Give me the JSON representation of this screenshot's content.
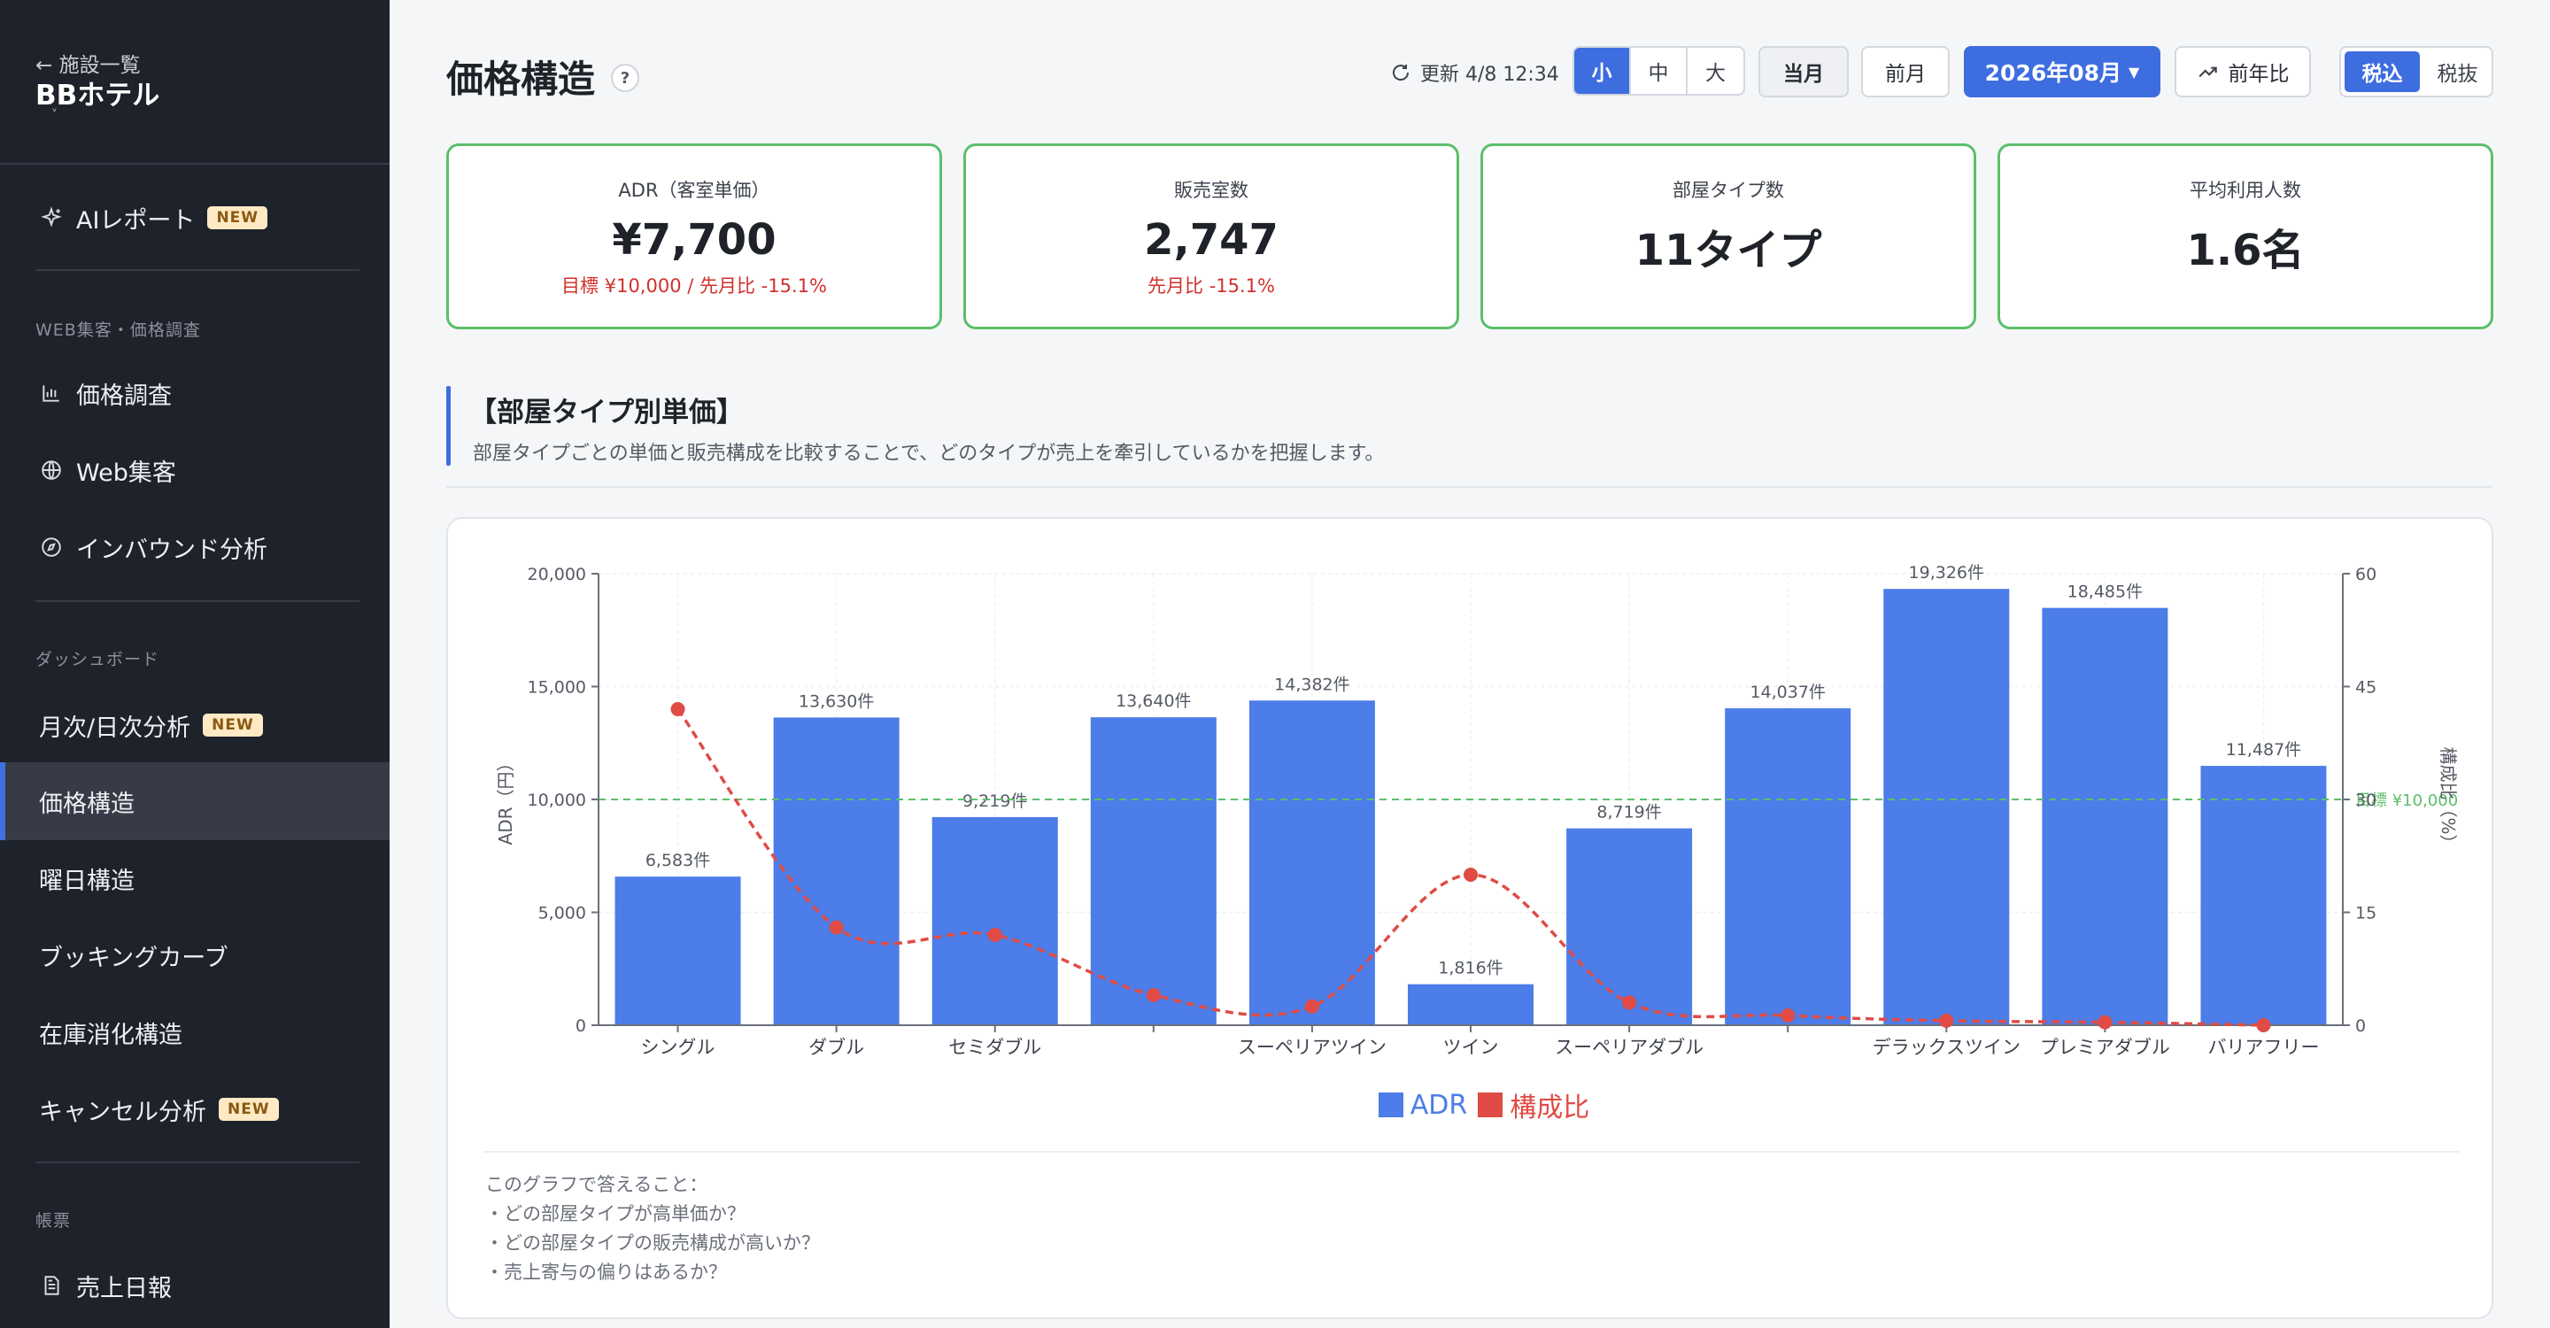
{
  "sidebar": {
    "back": "← 施設一覧",
    "hotel": "BBホテル",
    "caret": "˅",
    "ai_report": "AIレポート",
    "new_badge": "NEW",
    "section_web": "WEB集客・価格調査",
    "price_survey": "価格調査",
    "web_marketing": "Web集客",
    "inbound": "インバウンド分析",
    "section_dashboard": "ダッシュボード",
    "monthly_daily": "月次/日次分析",
    "price_structure": "価格構造",
    "weekday_structure": "曜日構造",
    "booking_curve": "ブッキングカーブ",
    "inventory": "在庫消化構造",
    "cancel": "キャンセル分析",
    "section_reports": "帳票",
    "daily_sales": "売上日報"
  },
  "header": {
    "title": "価格構造",
    "help": "?",
    "updated": "更新 4/8 12:34",
    "size_small": "小",
    "size_medium": "中",
    "size_large": "大",
    "this_month": "当月",
    "prev_month": "前月",
    "month": "2026年08月",
    "yoy": "前年比",
    "tax_incl": "税込",
    "tax_excl": "税抜"
  },
  "kpis": [
    {
      "label": "ADR（客室単価）",
      "value": "¥7,700",
      "sub": "目標 ¥10,000 / 先月比 -15.1%"
    },
    {
      "label": "販売室数",
      "value": "2,747",
      "sub": "先月比 -15.1%"
    },
    {
      "label": "部屋タイプ数",
      "value": "11タイプ",
      "sub": ""
    },
    {
      "label": "平均利用人数",
      "value": "1.6名",
      "sub": ""
    }
  ],
  "section": {
    "title": "【部屋タイプ別単価】",
    "desc": "部屋タイプごとの単価と販売構成を比較することで、どのタイプが売上を牽引しているかを把握します。"
  },
  "chart_data": {
    "type": "bar",
    "categories": [
      "シングル",
      "ダブル",
      "セミダブル",
      "",
      "スーペリアツイン",
      "ツイン",
      "スーペリアダブル",
      "",
      "デラックスツイン",
      "プレミアダブル",
      "バリアフリー"
    ],
    "series": [
      {
        "name": "ADR",
        "type": "bar",
        "axis": "left",
        "color": "#4c7de8",
        "values": [
          6583,
          13630,
          9219,
          13640,
          14382,
          1816,
          8719,
          14037,
          19326,
          18485,
          11487
        ],
        "labels": [
          "6,583件",
          "13,630件",
          "9,219件",
          "13,640件",
          "14,382件",
          "1,816件",
          "8,719件",
          "14,037件",
          "19,326件",
          "18,485件",
          "11,487件"
        ]
      },
      {
        "name": "構成比",
        "type": "line",
        "axis": "right",
        "color": "#e04b45",
        "style": "dashed-smooth",
        "values": [
          42,
          13,
          12,
          4,
          2.5,
          20,
          3,
          1.3,
          0.6,
          0.4,
          0
        ]
      }
    ],
    "ylabel": "ADR（円）",
    "ylabel_right": "構成比（%）",
    "ylim": [
      0,
      20000
    ],
    "yticks": [
      0,
      5000,
      10000,
      15000,
      20000
    ],
    "ytick_labels": [
      "0",
      "5,000",
      "10,000",
      "15,000",
      "20,000"
    ],
    "ylim_right": [
      0,
      60
    ],
    "yticks_right": [
      0,
      15,
      30,
      45,
      60
    ],
    "ytick_labels_right": [
      "0",
      "15",
      "30",
      "45",
      "60"
    ],
    "target": {
      "value": 10000,
      "label": "目標 ¥10,000",
      "color": "#5cbf6a"
    },
    "grid": true,
    "legend": "bottom"
  },
  "notes": {
    "heading": "このグラフで答えること：",
    "q1": "・どの部屋タイプが高単価か？",
    "q2": "・どの部屋タイプの販売構成が高いか？",
    "q3": "・売上寄与の偏りはあるか？"
  }
}
